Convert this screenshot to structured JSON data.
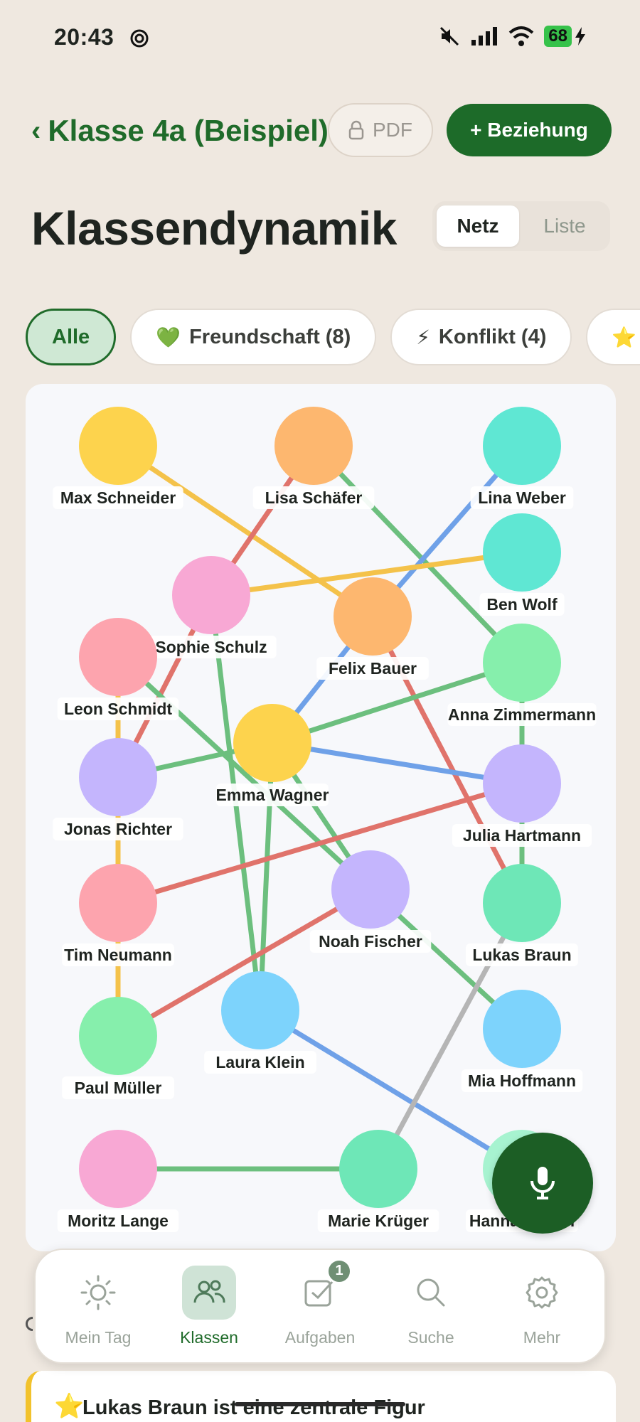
{
  "status": {
    "time": "20:43",
    "battery": "68"
  },
  "header": {
    "back_label": "Klasse 4a (Beispiel)",
    "pdf_label": "PDF",
    "add_label": "+ Beziehung"
  },
  "title": "Klassendynamik",
  "view_toggle": {
    "options": [
      "Netz",
      "Liste"
    ],
    "selected": "Netz"
  },
  "filters": [
    {
      "label": "Alle",
      "icon": "",
      "active": true
    },
    {
      "label": "Freundschaft (8)",
      "icon": "💚",
      "active": false
    },
    {
      "label": "Konflikt (4)",
      "icon": "⚡",
      "active": false
    },
    {
      "label": "",
      "icon": "⭐",
      "active": false
    }
  ],
  "colors": {
    "accent": "#1d6b29",
    "friendship": "#6cbf7e",
    "conflict": "#e0736b",
    "help": "#f4c24a",
    "support": "#6fa1e8",
    "neutral": "#b5b5b5"
  },
  "network": {
    "nodes": [
      {
        "id": "max",
        "name": "Max Schneider",
        "color": "#fdd34d"
      },
      {
        "id": "lisa",
        "name": "Lisa Schäfer",
        "color": "#fdb76f"
      },
      {
        "id": "lina",
        "name": "Lina Weber",
        "color": "#5fe7d3"
      },
      {
        "id": "ben",
        "name": "Ben Wolf",
        "color": "#5fe7d3"
      },
      {
        "id": "sophie",
        "name": "Sophie Schulz",
        "color": "#f8a8d4"
      },
      {
        "id": "felix",
        "name": "Felix Bauer",
        "color": "#fdb76f"
      },
      {
        "id": "leon",
        "name": "Leon Schmidt",
        "color": "#fda4ae"
      },
      {
        "id": "anna",
        "name": "Anna Zimmermann",
        "color": "#86efac"
      },
      {
        "id": "emma",
        "name": "Emma Wagner",
        "color": "#fdd34d"
      },
      {
        "id": "jonas",
        "name": "Jonas Richter",
        "color": "#c4b5fd"
      },
      {
        "id": "julia",
        "name": "Julia Hartmann",
        "color": "#c4b5fd"
      },
      {
        "id": "tim",
        "name": "Tim Neumann",
        "color": "#fda4ae"
      },
      {
        "id": "noah",
        "name": "Noah Fischer",
        "color": "#c4b5fd"
      },
      {
        "id": "lukas",
        "name": "Lukas Braun",
        "color": "#6ee7b7"
      },
      {
        "id": "laura",
        "name": "Laura Klein",
        "color": "#7dd3fc"
      },
      {
        "id": "paul",
        "name": "Paul Müller",
        "color": "#86efac"
      },
      {
        "id": "mia",
        "name": "Mia Hoffmann",
        "color": "#7dd3fc"
      },
      {
        "id": "moritz",
        "name": "Moritz Lange",
        "color": "#f8a8d4"
      },
      {
        "id": "marie",
        "name": "Marie Krüger",
        "color": "#6ee7b7"
      },
      {
        "id": "hannah",
        "name": "Hannah Koch",
        "color": "#a7f3d0"
      }
    ],
    "edges": [
      {
        "from": "max",
        "to": "felix",
        "type": "help"
      },
      {
        "from": "lisa",
        "to": "sophie",
        "type": "conflict"
      },
      {
        "from": "lisa",
        "to": "anna",
        "type": "friendship"
      },
      {
        "from": "lina",
        "to": "felix",
        "type": "support"
      },
      {
        "from": "sophie",
        "to": "ben",
        "type": "help"
      },
      {
        "from": "sophie",
        "to": "jonas",
        "type": "conflict"
      },
      {
        "from": "sophie",
        "to": "laura",
        "type": "friendship"
      },
      {
        "from": "felix",
        "to": "emma",
        "type": "support"
      },
      {
        "from": "felix",
        "to": "lukas",
        "type": "conflict"
      },
      {
        "from": "leon",
        "to": "noah",
        "type": "friendship"
      },
      {
        "from": "leon",
        "to": "jonas",
        "type": "help"
      },
      {
        "from": "anna",
        "to": "emma",
        "type": "friendship"
      },
      {
        "from": "anna",
        "to": "julia",
        "type": "friendship"
      },
      {
        "from": "emma",
        "to": "julia",
        "type": "support"
      },
      {
        "from": "emma",
        "to": "jonas",
        "type": "friendship"
      },
      {
        "from": "emma",
        "to": "laura",
        "type": "friendship"
      },
      {
        "from": "emma",
        "to": "noah",
        "type": "friendship"
      },
      {
        "from": "jonas",
        "to": "tim",
        "type": "help"
      },
      {
        "from": "julia",
        "to": "tim",
        "type": "conflict"
      },
      {
        "from": "julia",
        "to": "lukas",
        "type": "friendship"
      },
      {
        "from": "tim",
        "to": "paul",
        "type": "help"
      },
      {
        "from": "noah",
        "to": "paul",
        "type": "conflict"
      },
      {
        "from": "noah",
        "to": "mia",
        "type": "friendship"
      },
      {
        "from": "laura",
        "to": "hannah",
        "type": "support"
      },
      {
        "from": "moritz",
        "to": "marie",
        "type": "friendship"
      },
      {
        "from": "marie",
        "to": "lukas",
        "type": "neutral"
      }
    ]
  },
  "nav": {
    "items": [
      {
        "label": "Mein Tag",
        "icon": "sun-icon",
        "active": false
      },
      {
        "label": "Klassen",
        "icon": "people-icon",
        "active": true
      },
      {
        "label": "Aufgaben",
        "icon": "checkbox-icon",
        "active": false,
        "badge": "1"
      },
      {
        "label": "Suche",
        "icon": "search-icon",
        "active": false
      },
      {
        "label": "Mehr",
        "icon": "gear-icon",
        "active": false
      }
    ]
  },
  "insight": {
    "icon": "⭐",
    "text": "Lukas Braun ist eine zentrale Figur"
  }
}
